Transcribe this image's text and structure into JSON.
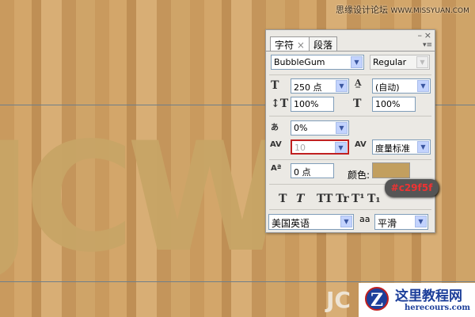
{
  "canvas": {
    "text": "JCW",
    "corner_text": "JC",
    "guide_color": "#6f7f8a"
  },
  "watermark_top": {
    "cn": "思缘设计论坛",
    "url": "WWW.MISSYUAN.COM"
  },
  "watermark_bottom": {
    "cn": "这里教程网",
    "url": "herecours.com"
  },
  "panel": {
    "tabs": [
      {
        "label": "字符",
        "close": "×"
      },
      {
        "label": "段落"
      }
    ],
    "controls": {
      "minimize": "–",
      "close": "×",
      "menu": "▾≡"
    },
    "font_family": "BubbleGum",
    "font_style": "Regular",
    "font_size": "250 点",
    "leading": "(自动)",
    "vertical_scale": "100%",
    "horizontal_scale": "100%",
    "tsume": "0%",
    "kerning": "10",
    "tracking": "度量标准",
    "baseline_shift": "0 点",
    "color_label": "颜色:",
    "color": "#c29f5f",
    "color_tooltip": "#c29f5f",
    "style_buttons": [
      "T",
      "T",
      "TT",
      "Tr",
      "T¹",
      "T₁"
    ],
    "language": "美国英语",
    "antialias_label": "aa",
    "antialias": "平滑"
  }
}
